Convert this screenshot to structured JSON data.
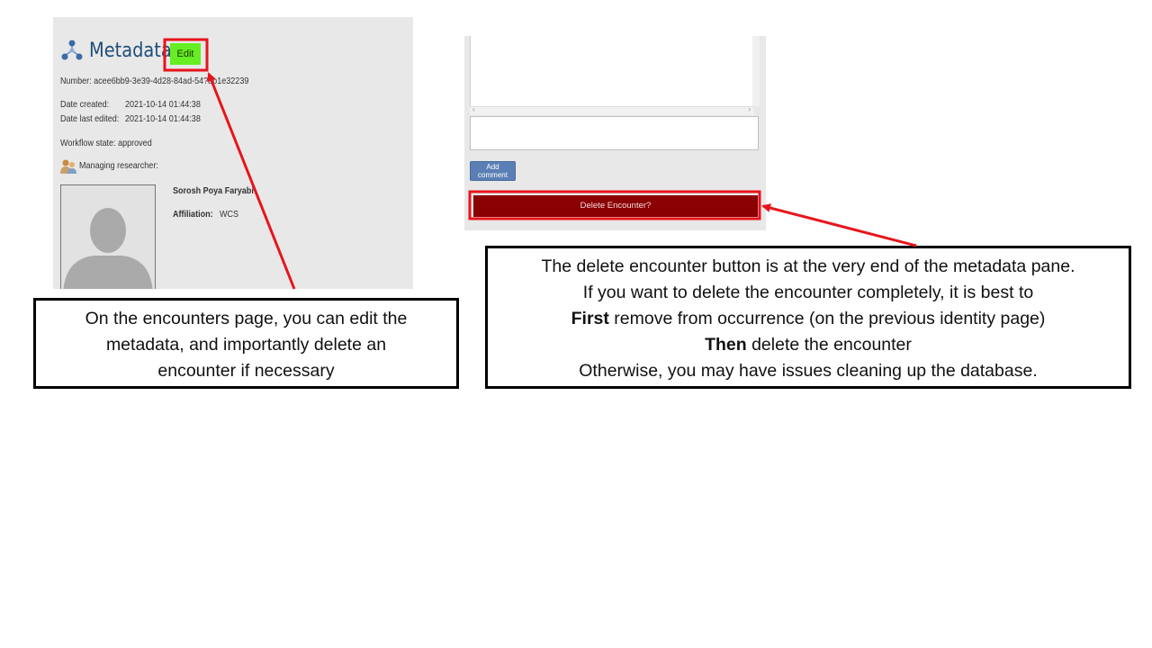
{
  "metadata_pane": {
    "title": "Metadata",
    "edit_label": "Edit",
    "number_line": "Number: acee6bb9-3e39-4d28-84ad-54?ab1e32239",
    "date_created_label": "Date created:",
    "date_created_value": "2021-10-14 01:44:38",
    "date_edited_label": "Date last edited:",
    "date_edited_value": "2021-10-14 01:44:38",
    "workflow_line": "Workflow state: approved",
    "managing_label": "Managing researcher:",
    "researcher_name": "Sorosh Poya Faryabi",
    "affiliation_label": "Affiliation:",
    "affiliation_value": "WCS"
  },
  "comment_pane": {
    "add_comment_label": "Add comment",
    "delete_label": "Delete Encounter?"
  },
  "callouts": {
    "left_lines": [
      "On the encounters page, you can edit the",
      "metadata, and importantly delete an",
      "encounter if necessary"
    ],
    "right_line1": "The delete encounter button is at the very end of the metadata pane.",
    "right_line2": "If you want to delete the encounter completely, it is best to",
    "right_line3_bold": "First",
    "right_line3_rest": " remove from occurrence (on the previous identity page)",
    "right_line4_bold": "Then",
    "right_line4_rest": " delete the encounter",
    "right_line5": "Otherwise, you may have issues cleaning up the database."
  },
  "colors": {
    "highlight_red": "#e8141c",
    "edit_green": "#66ee22",
    "delete_dark_red": "#8b0000",
    "add_comment_blue": "#5b7fb5",
    "title_blue": "#1f4e79"
  }
}
